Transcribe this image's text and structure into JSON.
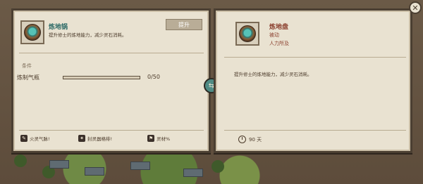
{
  "left_panel": {
    "title": "炼地锅",
    "description": "提升修士的炼地能力，减少灵石消耗。",
    "upgrade_label": "提升",
    "requirements_label": "条件",
    "requirement_name": "炼制气瓶",
    "progress_current": 0,
    "progress_text": "0/50",
    "bottom_items": [
      {
        "label": "火灵气脉!",
        "icon": "pen-icon"
      },
      {
        "label": "封灵器格绯!",
        "icon": "fire-icon"
      },
      {
        "label": "灵材%",
        "icon": "flag-icon"
      }
    ]
  },
  "right_panel": {
    "title": "炼地盘",
    "subtitle1": "被动",
    "subtitle2": "人力所及",
    "description": "提升修士的炼地能力，减少灵石消耗。",
    "duration_text": "90 天"
  },
  "close_icon": "close-icon",
  "hinge_icon": "arrow-icon"
}
